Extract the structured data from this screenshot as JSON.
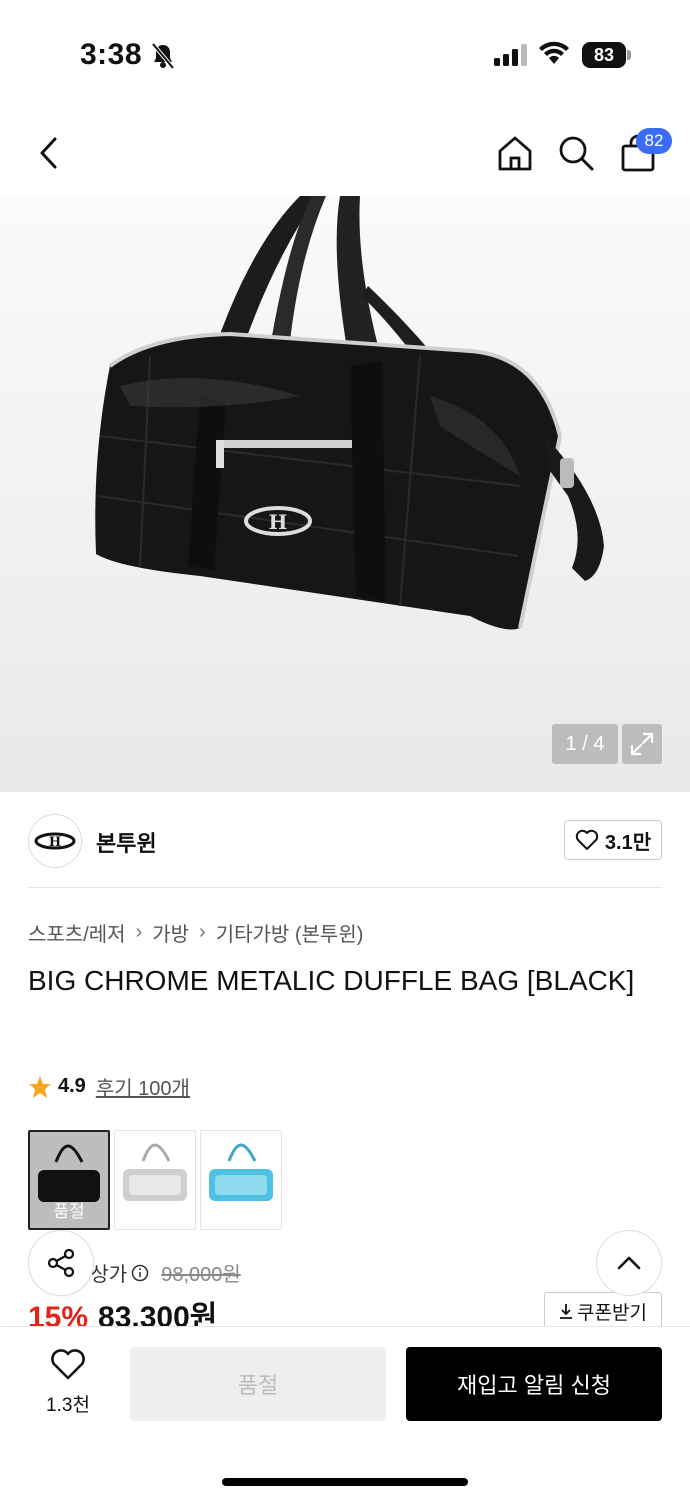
{
  "status_bar": {
    "time": "3:38",
    "battery": "83"
  },
  "nav": {
    "cart_count": "82",
    "icons": [
      "back-icon",
      "home-icon",
      "search-icon",
      "cart-icon"
    ]
  },
  "gallery": {
    "counter": "1 / 4"
  },
  "brand": {
    "name": "본투윈",
    "likes": "3.1만"
  },
  "breadcrumb": [
    "스포츠/레저",
    "가방",
    "기타가방 (본투윈)"
  ],
  "product": {
    "title": "BIG CHROME METALIC DUFFLE BAG [BLACK]",
    "rating": "4.9",
    "reviews": "후기 100개",
    "thumb_soldout_label": "품절",
    "price_label": "정상가",
    "original_price": "98,000원",
    "discount": "15%",
    "sale_price": "83,300원",
    "coupon_label": "쿠폰받기"
  },
  "bottom_bar": {
    "wish_count": "1.3천",
    "soldout_label": "품절",
    "restock_label": "재입고 알림 신청"
  },
  "colors": {
    "accent_blue": "#3a6cf4",
    "discount_red": "#e1251b"
  }
}
